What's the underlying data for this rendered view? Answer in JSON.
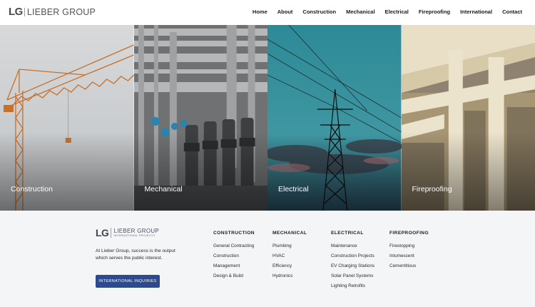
{
  "header": {
    "logo_mark": "LG",
    "logo_text": "LIEBER GROUP",
    "nav": [
      "Home",
      "About",
      "Construction",
      "Mechanical",
      "Electrical",
      "Fireproofing",
      "International",
      "Contact"
    ]
  },
  "hero": {
    "panels": [
      {
        "label": "Construction"
      },
      {
        "label": "Mechanical"
      },
      {
        "label": "Electrical"
      },
      {
        "label": "Fireproofing"
      }
    ]
  },
  "footer": {
    "logo_mark": "LG",
    "logo_name": "LIEBER GROUP",
    "logo_sub": "INTERNATIONAL PROJECTS",
    "tagline": "At Lieber Group, success is the output which serves the public interest.",
    "button_label": "INTERNATIONAL INQUIRIES",
    "columns": [
      {
        "title": "CONSTRUCTION",
        "links": [
          "General Contracting",
          "Construction",
          "Management",
          "Design & Build"
        ]
      },
      {
        "title": "MECHANICAL",
        "links": [
          "Plumbing",
          "HVAC",
          "Efficiency",
          "Hydronics"
        ]
      },
      {
        "title": "ELECTRICAL",
        "links": [
          "Maintenance",
          "Construction Projects",
          "EV Charging Stations",
          "Solar Panel Systems",
          "Lighting Retrofits"
        ]
      },
      {
        "title": "FIREPROOFING",
        "links": [
          "Firestopping",
          "Intumescent",
          "Cementitious"
        ]
      }
    ]
  },
  "colors": {
    "button_bg": "#2c4a8c",
    "footer_bg": "#f4f5f7",
    "crane": "#c9702a",
    "sky_teal": "#2f8c98"
  }
}
